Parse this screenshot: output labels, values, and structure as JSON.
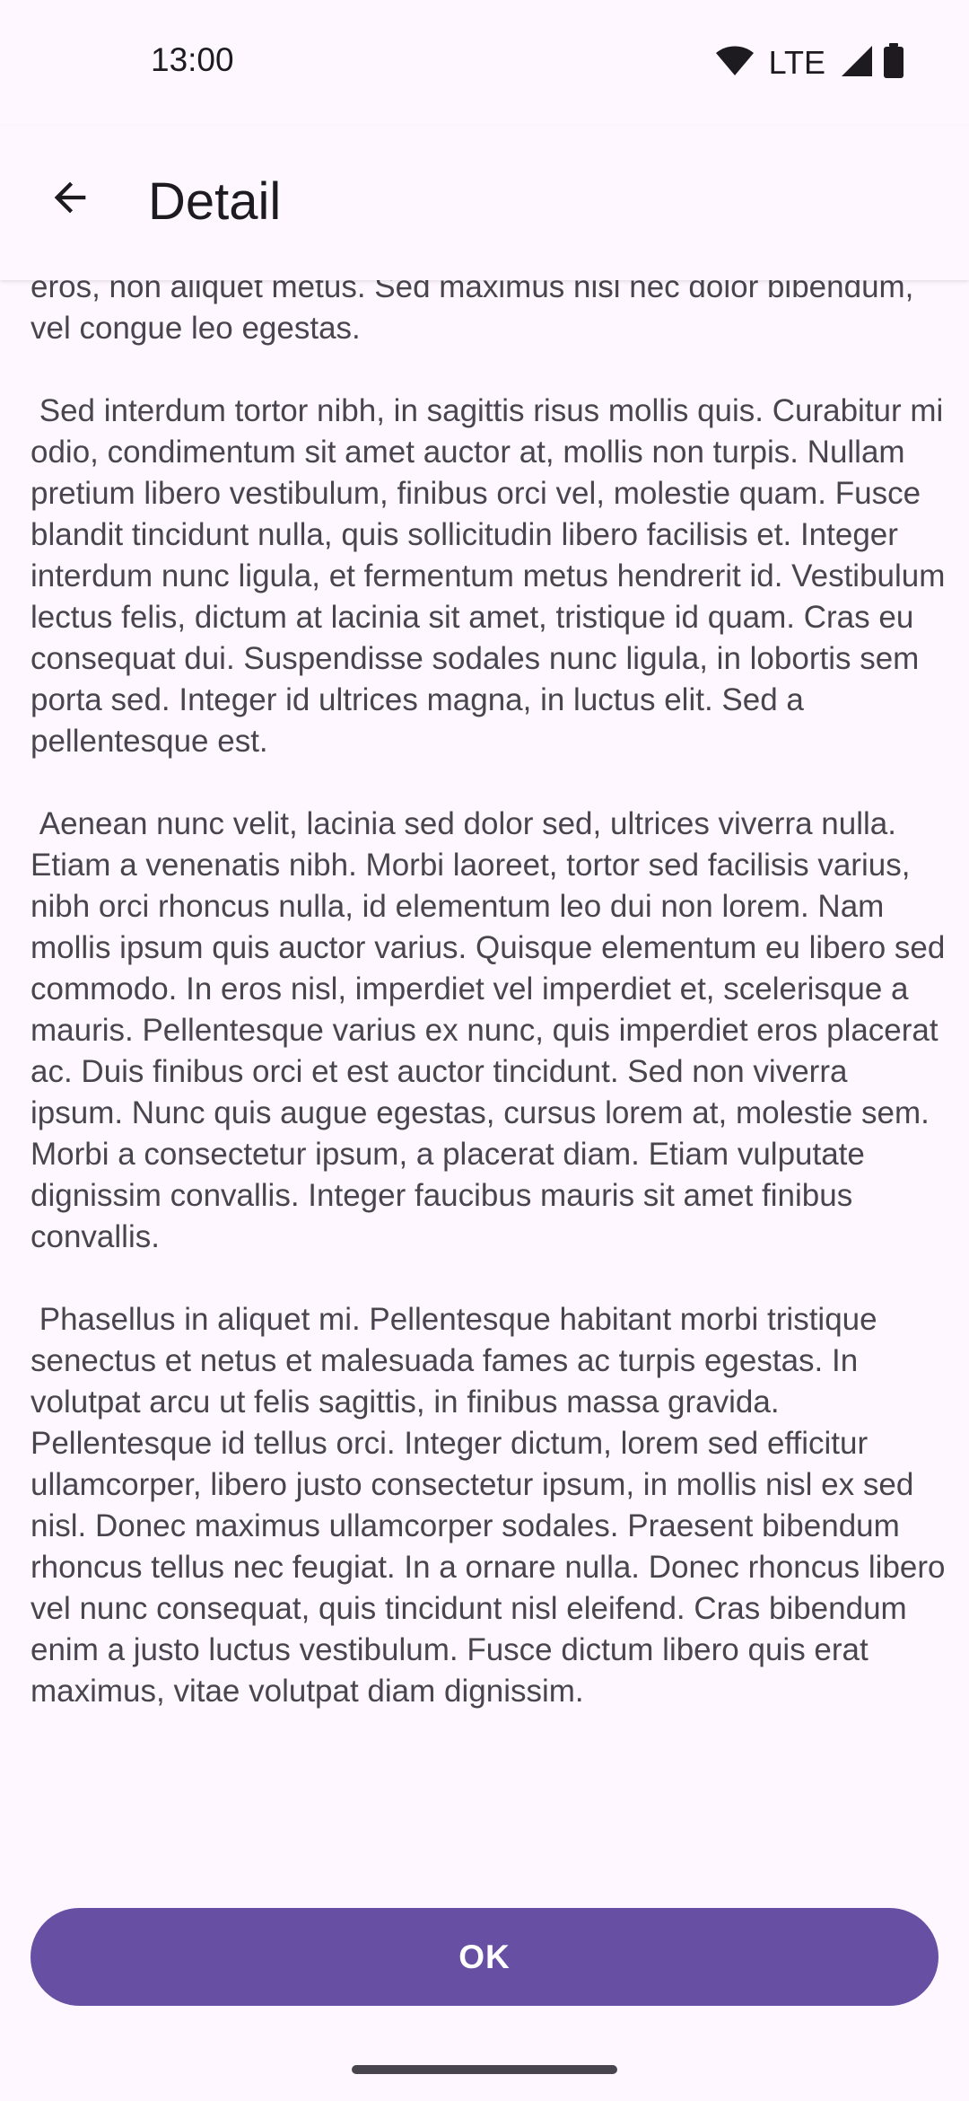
{
  "status_bar": {
    "time": "13:00",
    "network": "LTE",
    "icons": [
      "wifi-icon",
      "signal-icon",
      "battery-icon"
    ]
  },
  "app_bar": {
    "title": "Detail",
    "back_icon": "arrow-back-icon"
  },
  "content": {
    "paragraphs": [
      "eros, non aliquet metus. Sed maximus nisl nec dolor bibendum, vel congue leo egestas.",
      " Sed interdum tortor nibh, in sagittis risus mollis quis. Curabitur mi odio, condimentum sit amet auctor at, mollis non turpis. Nullam pretium libero vestibulum, finibus orci vel, molestie quam. Fusce blandit tincidunt nulla, quis sollicitudin libero facilisis et. Integer interdum nunc ligula, et fermentum metus hendrerit id. Vestibulum lectus felis, dictum at lacinia sit amet, tristique id quam. Cras eu consequat dui. Suspendisse sodales nunc ligula, in lobortis sem porta sed. Integer id ultrices magna, in luctus elit. Sed a pellentesque est.",
      " Aenean nunc velit, lacinia sed dolor sed, ultrices viverra nulla. Etiam a venenatis nibh. Morbi laoreet, tortor sed facilisis varius, nibh orci rhoncus nulla, id elementum leo dui non lorem. Nam mollis ipsum quis auctor varius. Quisque elementum eu libero sed commodo. In eros nisl, imperdiet vel imperdiet et, scelerisque a mauris. Pellentesque varius ex nunc, quis imperdiet eros placerat ac. Duis finibus orci et est auctor tincidunt. Sed non viverra ipsum. Nunc quis augue egestas, cursus lorem at, molestie sem. Morbi a consectetur ipsum, a placerat diam. Etiam vulputate dignissim convallis. Integer faucibus mauris sit amet finibus convallis.",
      " Phasellus in aliquet mi. Pellentesque habitant morbi tristique senectus et netus et malesuada fames ac turpis egestas. In volutpat arcu ut felis sagittis, in finibus massa gravida. Pellentesque id tellus orci. Integer dictum, lorem sed efficitur ullamcorper, libero justo consectetur ipsum, in mollis nisl ex sed nisl. Donec maximus ullamcorper sodales. Praesent bibendum rhoncus tellus nec feugiat. In a ornare nulla. Donec rhoncus libero vel nunc consequat, quis tincidunt nisl eleifend. Cras bibendum enim a justo luctus vestibulum. Fusce dictum libero quis erat maximus, vitae volutpat diam dignissim."
    ]
  },
  "actions": {
    "ok_label": "OK"
  },
  "colors": {
    "background": "#FEF7FF",
    "primary": "#6750A4",
    "on_primary": "#FFFFFF",
    "body_text": "#49454F",
    "title_text": "#1D1B20"
  }
}
